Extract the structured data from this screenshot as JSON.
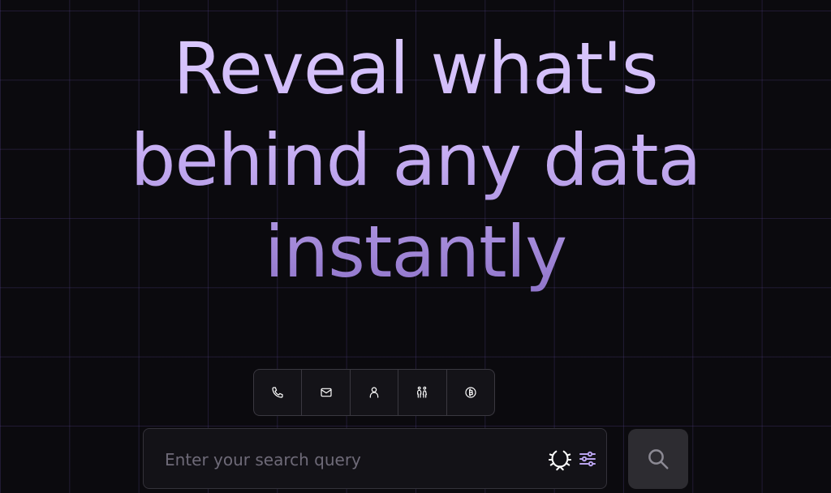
{
  "hero": {
    "headline_lines": [
      "Reveal what's",
      "behind any data",
      "instantly"
    ]
  },
  "categories": [
    {
      "icon": "phone-icon"
    },
    {
      "icon": "mail-icon"
    },
    {
      "icon": "person-icon"
    },
    {
      "icon": "family-icon"
    },
    {
      "icon": "bitcoin-icon"
    }
  ],
  "search": {
    "value": "",
    "placeholder": "Enter your search query",
    "icons": [
      "laurel-icon",
      "filter-sliders-icon",
      "search-icon"
    ]
  },
  "colors": {
    "background": "#0b0a0e",
    "headline_top": "#dccbff",
    "headline_bottom": "#8e73c9",
    "accent_icon": "#b9a3ee",
    "search_button_bg": "#2d2c31"
  }
}
